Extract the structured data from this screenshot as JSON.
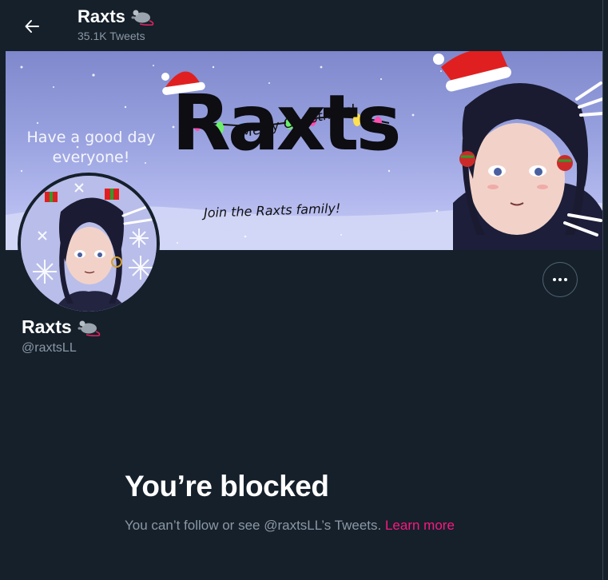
{
  "header": {
    "title": "Raxts",
    "tweet_count": "35.1K Tweets",
    "back_icon": "arrow-left-icon",
    "emoji_icon": "rat-icon"
  },
  "banner": {
    "merry": "Merry Christmas!",
    "logo": "Raxts",
    "greeting_line1": "Have a good day",
    "greeting_line2": "everyone!",
    "join": "Join the Raxts family!"
  },
  "profile": {
    "name": "Raxts",
    "handle": "@raxtsLL",
    "more_icon": "more-dots-icon"
  },
  "blocked": {
    "title": "You’re blocked",
    "body": "You can’t follow or see @raxtsLL’s Tweets.",
    "link": "Learn more"
  },
  "colors": {
    "background": "#15202b",
    "secondary_text": "#8b98a5",
    "accent_link": "#f91880",
    "border": "#38444d"
  }
}
